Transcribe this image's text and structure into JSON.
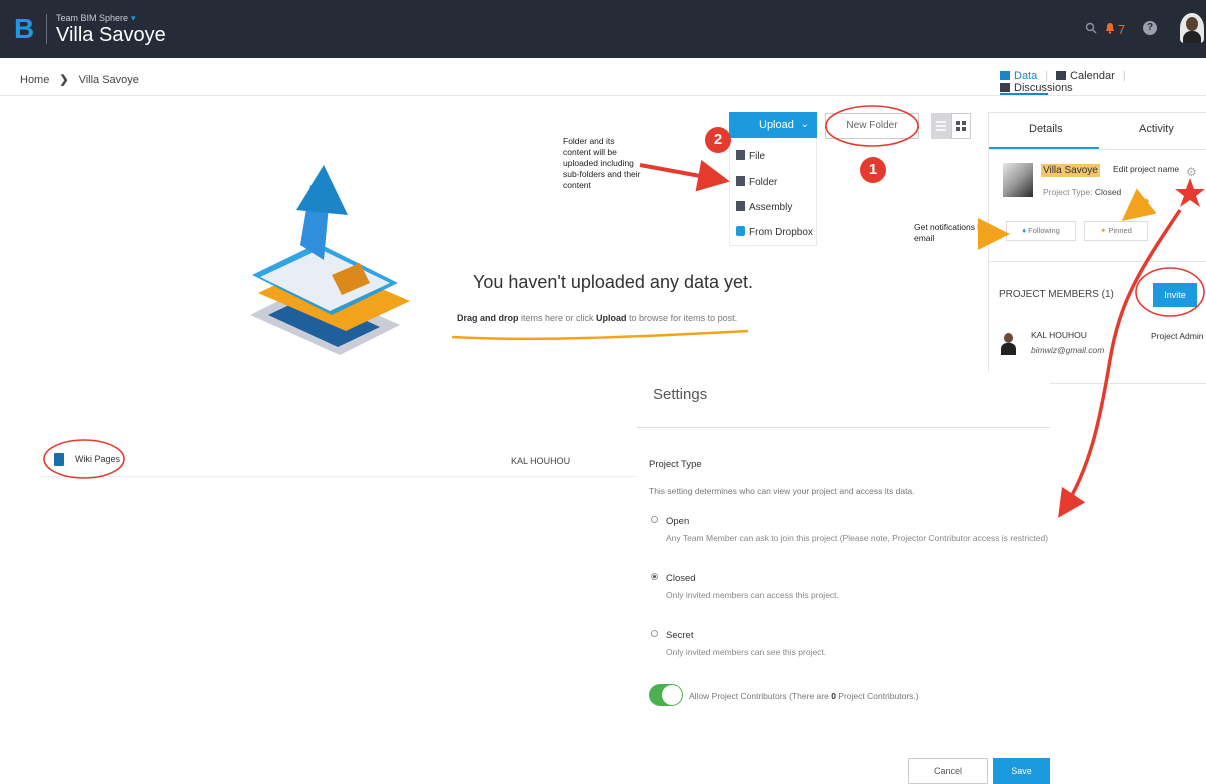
{
  "header": {
    "logo": "B",
    "team_name": "Team BIM Sphere",
    "team_caret": "▾",
    "project_title": "Villa Savoye",
    "notification_count": "7",
    "help_glyph": "?"
  },
  "breadcrumb": {
    "home": "Home",
    "separator": "❯",
    "current": "Villa Savoye"
  },
  "nav_tabs": {
    "data": "Data",
    "calendar": "Calendar",
    "discussions": "Discussions",
    "separator": "|"
  },
  "toolbar": {
    "upload_label": "Upload",
    "upload_chevron": "⌄",
    "new_folder_label": "New Folder",
    "grid_glyph": "▪▪"
  },
  "upload_menu": [
    {
      "label": "File",
      "icon": "file-icon"
    },
    {
      "label": "Folder",
      "icon": "folder-icon"
    },
    {
      "label": "Assembly",
      "icon": "assembly-icon"
    },
    {
      "label": "From Dropbox",
      "icon": "dropbox-icon"
    }
  ],
  "annotations": {
    "folder_note": [
      "Folder and its",
      "content will be",
      "uploaded including",
      "sub-folders and their",
      "content"
    ],
    "notify_note": [
      "Get notifications by",
      "email"
    ],
    "step1": "1",
    "step2": "2"
  },
  "empty_state": {
    "title": "You haven't uploaded any data yet.",
    "drag_bold": "Drag and drop",
    "mid_text": " items here or click ",
    "upload_bold": "Upload",
    "end_text": " to browse for items to post."
  },
  "details_panel": {
    "tab_details": "Details",
    "tab_activity": "Activity",
    "project_name": "Villa Savoye",
    "edit_hint": "Edit project name",
    "project_type_label": "Project Type: ",
    "project_type_value": "Closed",
    "following_label": "Following",
    "pinned_label": "Pinned",
    "members_title": "PROJECT MEMBERS (1)",
    "invite_label": "Invite",
    "member_name": "KAL HOUHOU",
    "member_email": "bimwiz@gmail.com",
    "member_role": "Project Admin"
  },
  "wiki": {
    "label": "Wiki Pages",
    "owner": "KAL HOUHOU"
  },
  "settings": {
    "title": "Settings",
    "project_type_heading": "Project Type",
    "project_type_desc": "This setting determines who can view your project and access its data.",
    "options": [
      {
        "label": "Open",
        "desc": "Any Team Member can ask to join this project (Please note, Projector Contributor access is restricted)",
        "checked": false
      },
      {
        "label": "Closed",
        "desc": "Only invited members can access this project.",
        "checked": true
      },
      {
        "label": "Secret",
        "desc": "Only invited members can see this project.",
        "checked": false
      }
    ],
    "toggle_on": true,
    "toggle_text_before": "Allow Project Contributors (There are ",
    "toggle_count": "0",
    "toggle_text_after": " Project Contributors.)",
    "cancel_label": "Cancel",
    "save_label": "Save"
  },
  "colors": {
    "topbar": "#262b38",
    "accent": "#1b9ae0",
    "annotation_red": "#e53b2e",
    "annotation_orange": "#f2a31b",
    "toggle_green": "#4caf50"
  }
}
